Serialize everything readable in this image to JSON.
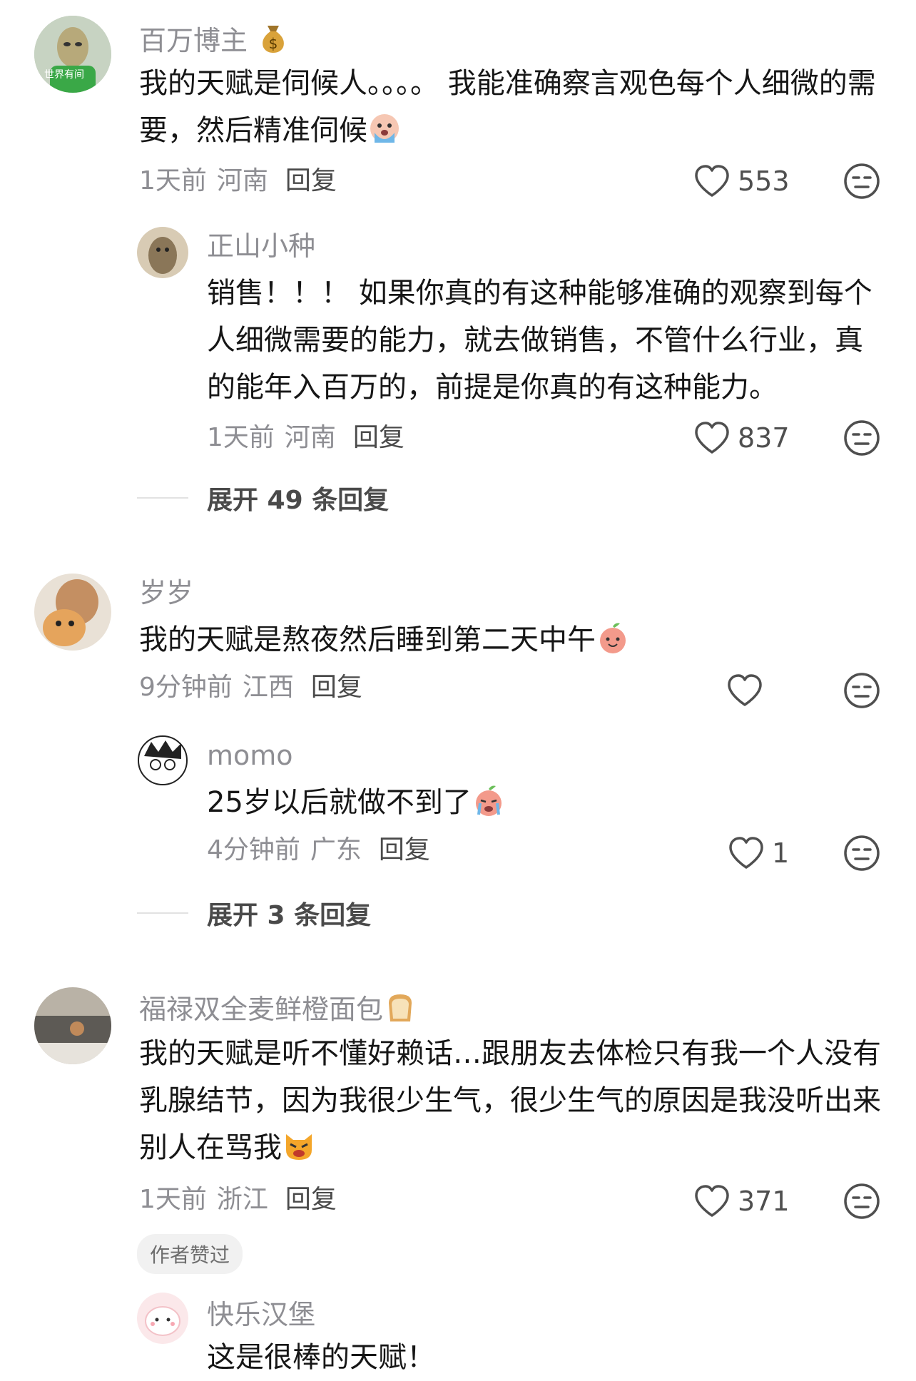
{
  "comments": [
    {
      "username": "百万博主",
      "avatar_text": "世界有间",
      "text": "我的天赋是伺候人。。。。 我能准确察言观色每个人细微的需要，然后精准伺候",
      "time": "1天前",
      "location": "河南",
      "reply_label": "回复",
      "likes": "553",
      "replies": [
        {
          "username": "正山小种",
          "text": "销售！！！ 如果你真的有这种能够准确的观察到每个人细微需要的能力，就去做销售，不管什么行业，真的能年入百万的，前提是你真的有这种能力。",
          "time": "1天前",
          "location": "河南",
          "reply_label": "回复",
          "likes": "837"
        }
      ],
      "expand_label": "展开 49 条回复"
    },
    {
      "username": "岁岁",
      "text": "我的天赋是熬夜然后睡到第二天中午",
      "time": "9分钟前",
      "location": "江西",
      "reply_label": "回复",
      "likes": "",
      "replies": [
        {
          "username": "momo",
          "text": "25岁以后就做不到了",
          "time": "4分钟前",
          "location": "广东",
          "reply_label": "回复",
          "likes": "1"
        }
      ],
      "expand_label": "展开 3 条回复"
    },
    {
      "username": "福禄双全麦鲜橙面包",
      "text": "我的天赋是听不懂好赖话…跟朋友去体检只有我一个人没有乳腺结节，因为我很少生气，很少生气的原因是我没听出来别人在骂我",
      "time": "1天前",
      "location": "浙江",
      "reply_label": "回复",
      "likes": "371",
      "author_liked_badge": "作者赞过",
      "replies": [
        {
          "username": "快乐汉堡",
          "text": "这是很棒的天赋！"
        }
      ]
    }
  ],
  "colors": {
    "text": "#161616",
    "muted": "#8e8e93",
    "icon": "#4f4f4f"
  },
  "icons": [
    "heart-icon",
    "meh-face-icon",
    "money-bag-icon",
    "crying-emoji",
    "peach-smile-emoji",
    "angry-cat-emoji",
    "bread-emoji"
  ]
}
